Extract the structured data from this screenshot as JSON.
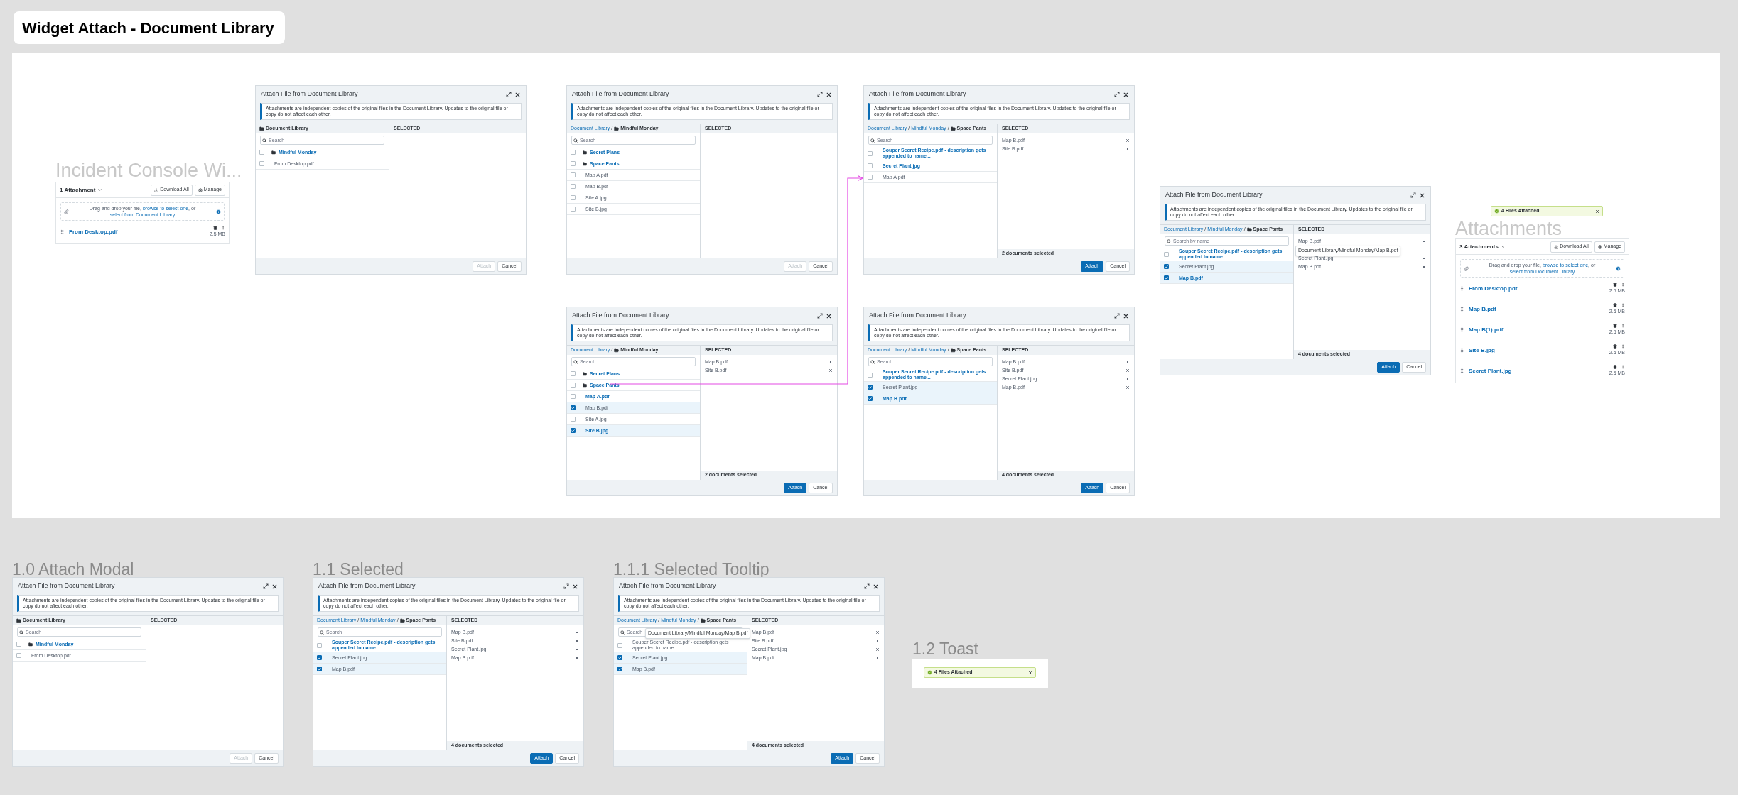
{
  "page_title": "Widget Attach - Document Library",
  "board": {
    "incident": {
      "heading": "Incident Console Wi...",
      "widget": {
        "count_label": "1 Attachment",
        "buttons": [
          {
            "label": "Download All",
            "kind": "download"
          },
          {
            "label": "Manage",
            "kind": "manage"
          }
        ],
        "dropzone": {
          "lead": "Drag and drop your file,",
          "browse_link": "browse to select one",
          "joiner": ", or",
          "library_link": "select from Document Library"
        },
        "files": [
          {
            "name": "From Desktop.pdf",
            "size": "2.5 MB"
          }
        ]
      }
    },
    "modals": [
      {
        "title": "Attach File from Document Library",
        "notice": "Attachments are independent copies of the original files in the Document Library. Updates to the original file or copy do not affect each other.",
        "breadcrumb": {
          "current": "Document Library"
        },
        "search_placeholder": "Search",
        "files": [
          {
            "name": "Mindful Monday",
            "kind": "folder",
            "checked": false,
            "link": true
          },
          {
            "name": "From Desktop.pdf",
            "kind": "file",
            "checked": false,
            "link": false
          }
        ],
        "selected_heading": "SELECTED",
        "attach": {
          "label": "Attach",
          "disabled": true
        },
        "cancel": "Cancel"
      },
      {
        "title": "Attach File from Document Library",
        "notice": "Attachments are independent copies of the original files in the Document Library. Updates to the original file or copy do not affect each other.",
        "breadcrumb": {
          "links": [
            "Document Library"
          ],
          "separator": "/",
          "current": "Mindful Monday"
        },
        "search_placeholder": "Search",
        "files": [
          {
            "name": "Secret Plans",
            "kind": "folder",
            "checked": false,
            "link": true
          },
          {
            "name": "Space Pants",
            "kind": "folder",
            "checked": false,
            "link": true
          },
          {
            "name": "Map A.pdf",
            "kind": "file",
            "checked": false,
            "link": false
          },
          {
            "name": "Map B.pdf",
            "kind": "file",
            "checked": false,
            "link": false
          },
          {
            "name": "Site A.jpg",
            "kind": "file",
            "checked": false,
            "link": false
          },
          {
            "name": "Site B.jpg",
            "kind": "file",
            "checked": false,
            "link": false
          }
        ],
        "selected_heading": "SELECTED",
        "attach": {
          "label": "Attach",
          "disabled": true
        },
        "cancel": "Cancel"
      },
      {
        "title": "Attach File from Document Library",
        "notice": "Attachments are independent copies of the original files in the Document Library. Updates to the original file or copy do not affect each other.",
        "breadcrumb": {
          "links": [
            "Document Library",
            "Mindful Monday"
          ],
          "separator": "/",
          "current": "Space Pants"
        },
        "search_placeholder": "Search",
        "files": [
          {
            "name": "Souper Secret Recipe.pdf - description gets appended to name...",
            "kind": "file",
            "checked": false,
            "link": true
          },
          {
            "name": "Secret Plant.jpg",
            "kind": "file",
            "checked": false,
            "link": true
          },
          {
            "name": "Map A.pdf",
            "kind": "file",
            "checked": false,
            "link": false
          }
        ],
        "selected_heading": "SELECTED",
        "selected": [
          {
            "name": "Map B.pdf",
            "covered": false
          },
          {
            "name": "Site B.pdf",
            "covered": false
          }
        ],
        "count": "2 documents selected",
        "attach": {
          "label": "Attach",
          "disabled": false
        },
        "cancel": "Cancel"
      },
      {
        "title": "Attach File from Document Library",
        "notice": "Attachments are independent copies of the original files in the Document Library. Updates to the original file or copy do not affect each other.",
        "breadcrumb": {
          "links": [
            "Document Library"
          ],
          "separator": "/",
          "current": "Mindful Monday"
        },
        "search_placeholder": "Search",
        "files": [
          {
            "name": "Secret Plans",
            "kind": "folder",
            "checked": false,
            "link": true
          },
          {
            "name": "Space Pants",
            "kind": "folder",
            "checked": false,
            "link": true
          },
          {
            "name": "Map A.pdf",
            "kind": "file",
            "checked": false,
            "link": true
          },
          {
            "name": "Map B.pdf",
            "kind": "file",
            "checked": true,
            "link": false
          },
          {
            "name": "Site A.jpg",
            "kind": "file",
            "checked": false,
            "link": false
          },
          {
            "name": "Site B.jpg",
            "kind": "file",
            "checked": true,
            "link": true
          }
        ],
        "selected_heading": "SELECTED",
        "selected": [
          {
            "name": "Map B.pdf",
            "covered": false
          },
          {
            "name": "Site B.pdf",
            "covered": false
          }
        ],
        "count": "2 documents selected",
        "attach": {
          "label": "Attach",
          "disabled": false
        },
        "cancel": "Cancel"
      },
      {
        "title": "Attach File from Document Library",
        "notice": "Attachments are independent copies of the original files in the Document Library. Updates to the original file or copy do not affect each other.",
        "breadcrumb": {
          "links": [
            "Document Library",
            "Mindful Monday"
          ],
          "separator": "/",
          "current": "Space Pants"
        },
        "search_placeholder": "Search",
        "files": [
          {
            "name": "Souper Secret Recipe.pdf - description gets appended to name...",
            "kind": "file",
            "checked": false,
            "link": true
          },
          {
            "name": "Secret Plant.jpg",
            "kind": "file",
            "checked": true,
            "link": false
          },
          {
            "name": "Map B.pdf",
            "kind": "file",
            "checked": true,
            "link": true
          }
        ],
        "selected_heading": "SELECTED",
        "selected": [
          {
            "name": "Map B.pdf",
            "covered": false
          },
          {
            "name": "Site B.pdf",
            "covered": false
          },
          {
            "name": "Secret Plant.jpg",
            "covered": false
          },
          {
            "name": "Map B.pdf",
            "covered": false
          }
        ],
        "count": "4 documents selected",
        "attach": {
          "label": "Attach",
          "disabled": false
        },
        "cancel": "Cancel"
      },
      {
        "title": "Attach File from Document Library",
        "notice": "Attachments are independent copies of the original files in the Document Library. Updates to the original file or copy do not affect each other.",
        "breadcrumb": {
          "links": [
            "Document Library",
            "Mindful Monday"
          ],
          "separator": "/",
          "current": "Space Pants"
        },
        "search_placeholder": "Search by name",
        "files": [
          {
            "name": "Souper Secret Recipe.pdf - description gets appended to name...",
            "kind": "file",
            "checked": false,
            "link": true
          },
          {
            "name": "Secret Plant.jpg",
            "kind": "file",
            "checked": true,
            "link": false
          },
          {
            "name": "Map B.pdf",
            "kind": "file",
            "checked": true,
            "link": true
          }
        ],
        "selected_heading": "SELECTED",
        "selected": [
          {
            "name": "Map B.pdf",
            "covered": false
          },
          {
            "covered": true
          },
          {
            "name": "Secret Plant.jpg",
            "covered": false
          },
          {
            "name": "Map B.pdf",
            "covered": false
          }
        ],
        "tooltip": {
          "text": "Document Library/Mindful Monday/Map B.pdf",
          "kind": "selected"
        },
        "count": "4 documents selected",
        "attach": {
          "label": "Attach",
          "disabled": false
        },
        "cancel": "Cancel"
      }
    ],
    "toast": {
      "message": "4 Files Attached"
    },
    "attachments": {
      "heading": "Attachments",
      "widget": {
        "count_label": "3 Attachments",
        "buttons": [
          {
            "label": "Download All",
            "kind": "download"
          },
          {
            "label": "Manage",
            "kind": "manage"
          }
        ],
        "dropzone": {
          "lead": "Drag and drop your file,",
          "browse_link": "browse to select one",
          "joiner": ", or",
          "library_link": "select from Document Library"
        },
        "files": [
          {
            "name": "From Desktop.pdf",
            "size": "2.5 MB"
          },
          {
            "name": "Map B.pdf",
            "size": "2.5 MB"
          },
          {
            "name": "Map B(1).pdf",
            "size": "2.5 MB"
          },
          {
            "name": "Site B.jpg",
            "size": "2.5 MB"
          },
          {
            "name": "Secret Plant.jpg",
            "size": "2.5 MB"
          }
        ]
      }
    }
  },
  "sections": [
    {
      "label": "1.0 Attach Modal",
      "kind": "modal",
      "modal": {
        "title": "Attach File from Document Library",
        "notice": "Attachments are independent copies of the original files in the Document Library. Updates to the original file or copy do not affect each other.",
        "breadcrumb": {
          "current": "Document Library"
        },
        "search_placeholder": "Search",
        "files": [
          {
            "name": "Mindful Monday",
            "kind": "folder",
            "checked": false,
            "link": true
          },
          {
            "name": "From Desktop.pdf",
            "kind": "file",
            "checked": false,
            "link": false
          }
        ],
        "selected_heading": "SELECTED",
        "attach": {
          "label": "Attach",
          "disabled": true
        },
        "cancel": "Cancel"
      }
    },
    {
      "label": "1.1 Selected",
      "kind": "modal",
      "modal": {
        "title": "Attach File from Document Library",
        "notice": "Attachments are independent copies of the original files in the Document Library. Updates to the original file or copy do not affect each other.",
        "breadcrumb": {
          "links": [
            "Document Library",
            "Mindful Monday"
          ],
          "separator": "/",
          "current": "Space Pants"
        },
        "search_placeholder": "Search",
        "files": [
          {
            "name": "Souper Secret Recipe.pdf - description gets appended to name...",
            "kind": "file",
            "checked": false,
            "link": true
          },
          {
            "name": "Secret Plant.jpg",
            "kind": "file",
            "checked": true,
            "link": false
          },
          {
            "name": "Map B.pdf",
            "kind": "file",
            "checked": true,
            "link": false
          }
        ],
        "selected_heading": "SELECTED",
        "selected": [
          {
            "name": "Map B.pdf",
            "covered": false
          },
          {
            "name": "Site B.pdf",
            "covered": false
          },
          {
            "name": "Secret Plant.jpg",
            "covered": false
          },
          {
            "name": "Map B.pdf",
            "covered": false
          }
        ],
        "count": "4 documents selected",
        "attach": {
          "label": "Attach",
          "disabled": false
        },
        "cancel": "Cancel"
      }
    },
    {
      "label": "1.1.1 Selected Tooltip",
      "kind": "modal",
      "modal": {
        "title": "Attach File from Document Library",
        "notice": "Attachments are independent copies of the original files in the Document Library. Updates to the original file or copy do not affect each other.",
        "breadcrumb": {
          "links": [
            "Document Library",
            "Mindful Monday"
          ],
          "separator": "/",
          "current": "Space Pants"
        },
        "search_placeholder": "Search",
        "files": [
          {
            "name": "Souper Secret Recipe.pdf - description gets appended to name...",
            "kind": "file",
            "checked": false,
            "link": false
          },
          {
            "name": "Secret Plant.jpg",
            "kind": "file",
            "checked": true,
            "link": false
          },
          {
            "name": "Map B.pdf",
            "kind": "file",
            "checked": true,
            "link": false
          }
        ],
        "selected_heading": "SELECTED",
        "selected": [
          {
            "name": "Map B.pdf",
            "covered": false
          },
          {
            "name": "Site B.pdf",
            "covered": false
          },
          {
            "name": "Secret Plant.jpg",
            "covered": false
          },
          {
            "name": "Map B.pdf",
            "covered": false
          }
        ],
        "tooltip": {
          "text": "Document Library/Mindful Monday/Map B.pdf",
          "kind": "search"
        },
        "count": "4 documents selected",
        "attach": {
          "label": "Attach",
          "disabled": false
        },
        "cancel": "Cancel"
      }
    },
    {
      "label": "1.2 Toast",
      "kind": "toast",
      "toast": {
        "message": "4 Files Attached"
      }
    }
  ]
}
